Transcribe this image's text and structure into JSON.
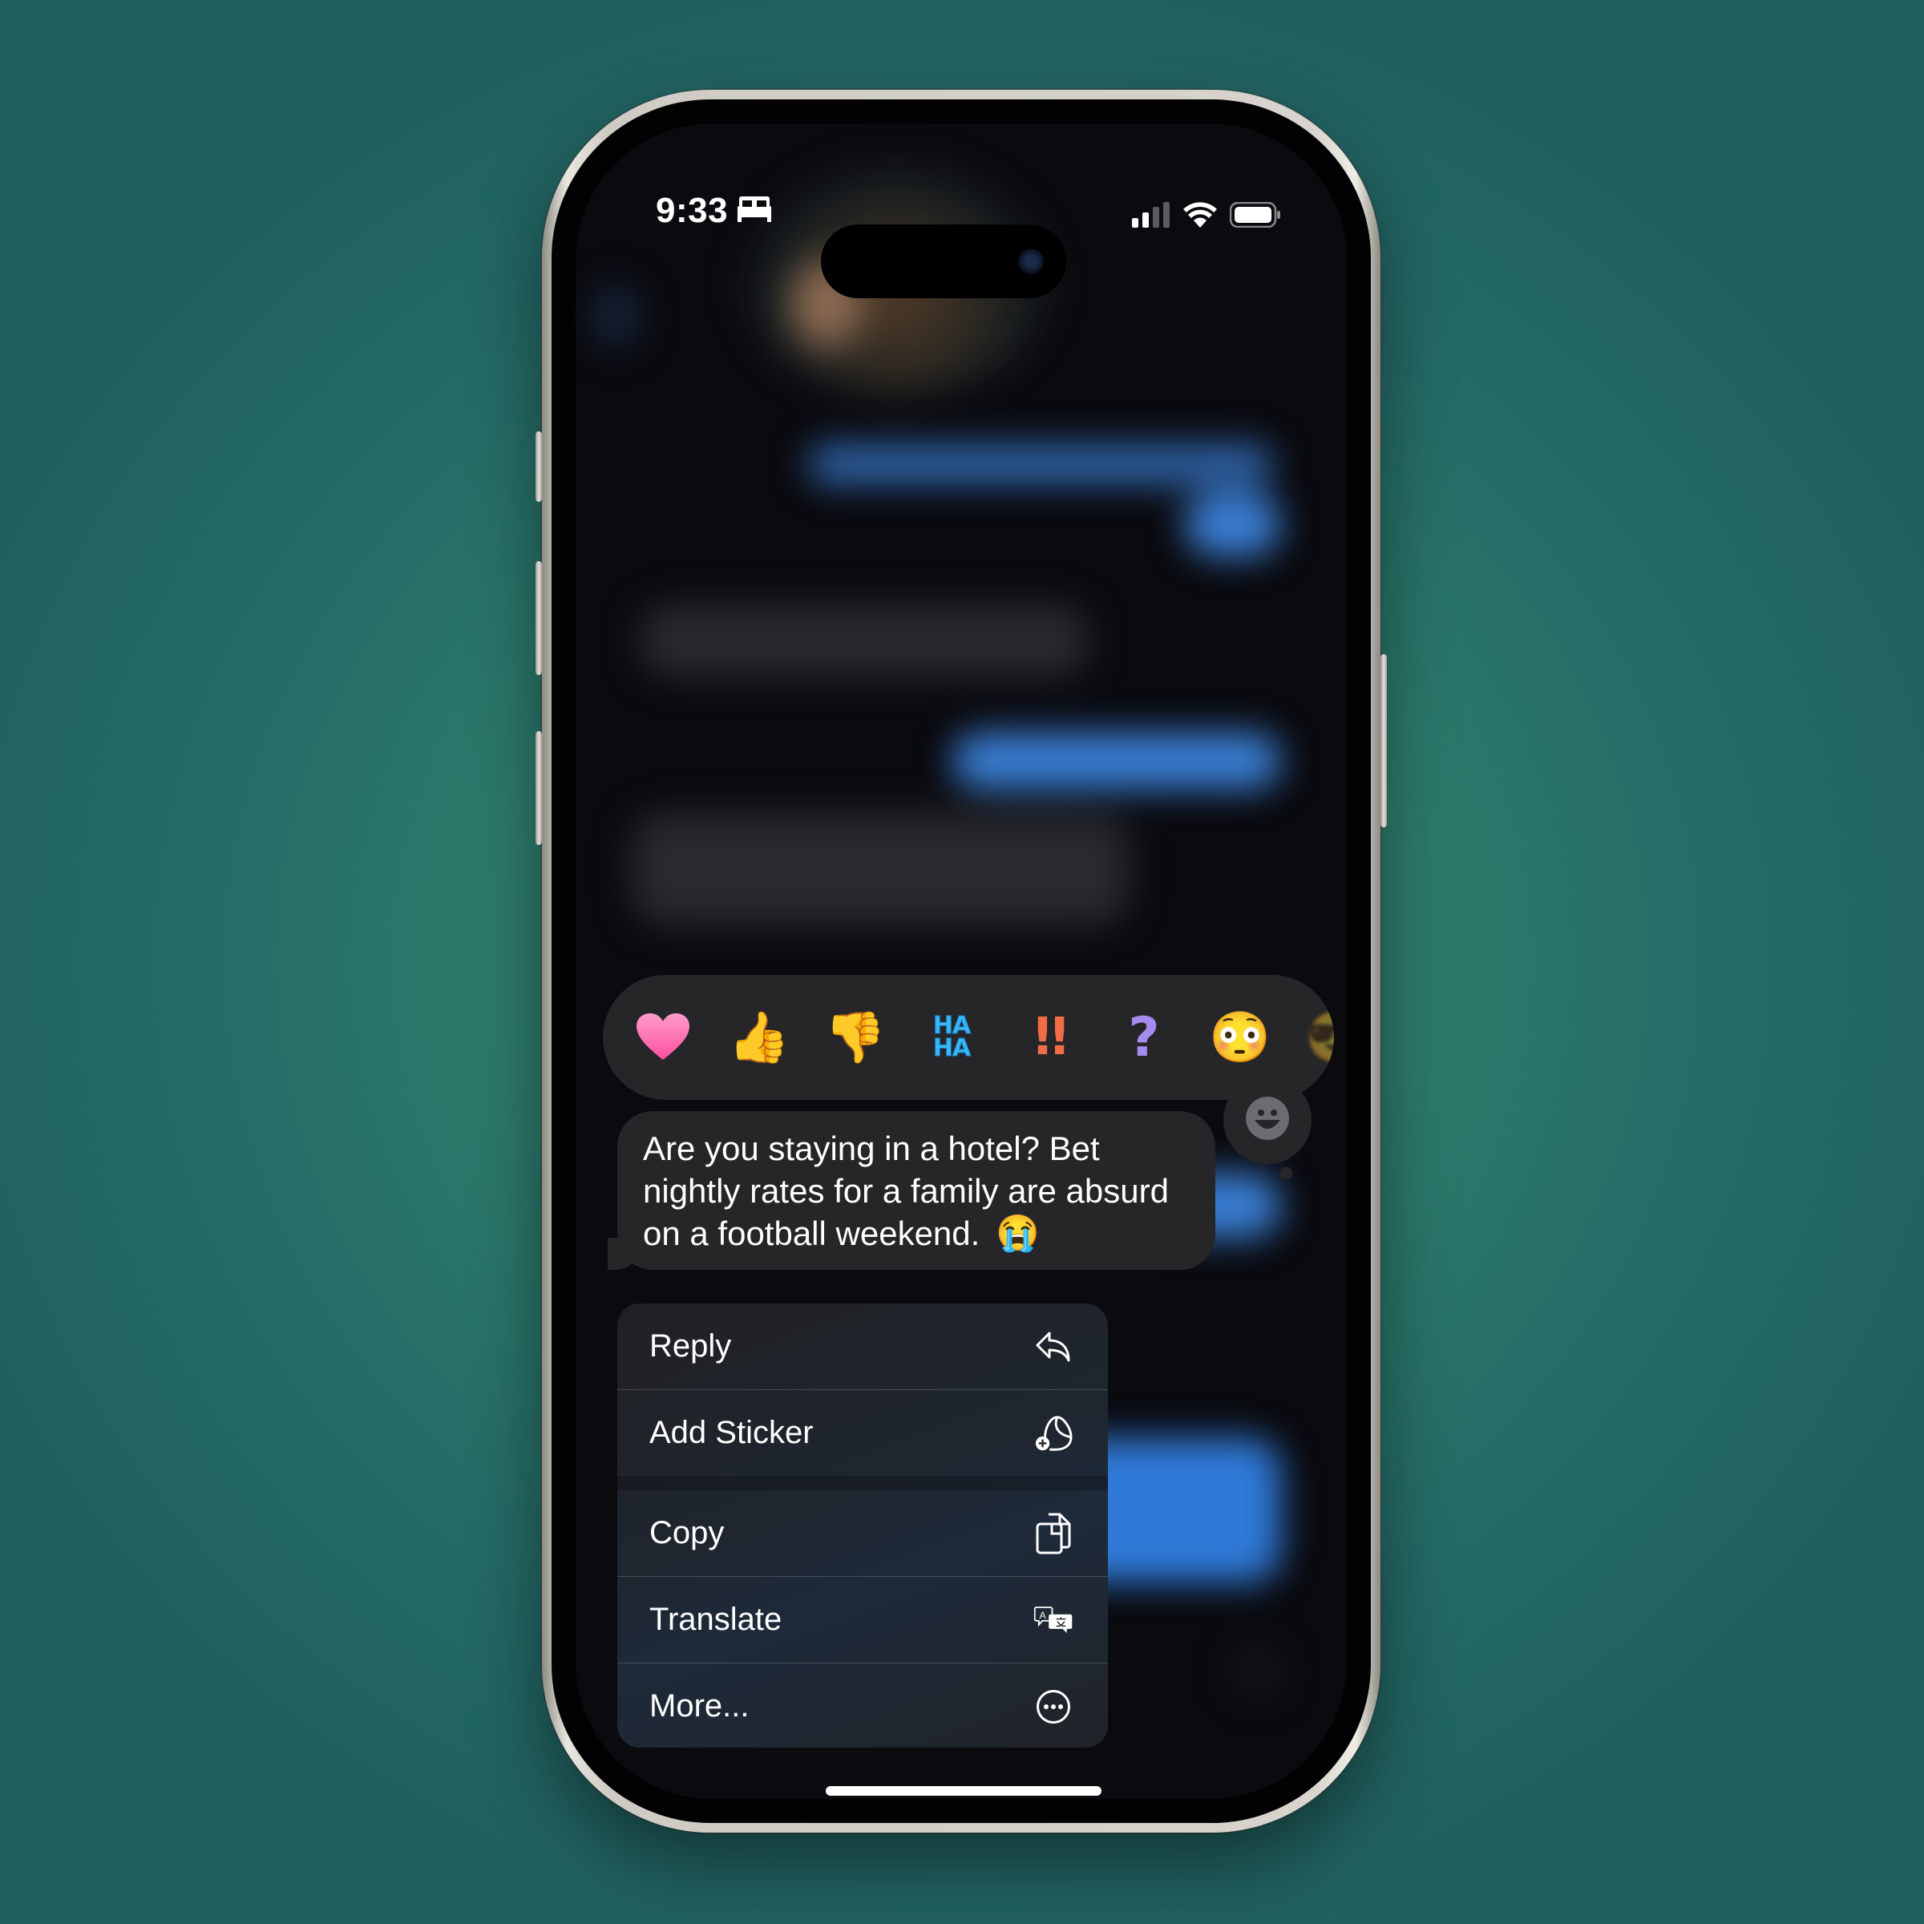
{
  "status_bar": {
    "time": "9:33",
    "focus_icon": "bed-icon",
    "signal_bars_active": 2,
    "signal_bars_total": 4,
    "wifi_icon": "wifi-icon",
    "battery_icon": "battery-icon"
  },
  "reactions": [
    {
      "name": "heart",
      "glyph": "❤"
    },
    {
      "name": "thumbs-up",
      "glyph": "👍"
    },
    {
      "name": "thumbs-down",
      "glyph": "👎"
    },
    {
      "name": "haha",
      "line1": "HA",
      "line2": "HA"
    },
    {
      "name": "exclamation",
      "glyph": "!!"
    },
    {
      "name": "question",
      "glyph": "?"
    },
    {
      "name": "flushed-face",
      "glyph": "😳"
    },
    {
      "name": "more-emoji-partial",
      "glyph": "😎"
    }
  ],
  "emoji_picker_icon": "smiley-face-icon",
  "message": {
    "text": "Are you staying in a hotel? Bet nightly rates for a family are absurd on a football weekend.",
    "emoji": "😭"
  },
  "menu": {
    "items": [
      {
        "label": "Reply",
        "icon": "reply-arrow-icon"
      },
      {
        "label": "Add Sticker",
        "icon": "add-sticker-icon"
      },
      {
        "label": "Copy",
        "icon": "copy-documents-icon"
      },
      {
        "label": "Translate",
        "icon": "translate-icon"
      },
      {
        "label": "More...",
        "icon": "ellipsis-circle-icon"
      }
    ]
  },
  "colors": {
    "background": "#2d7c6c",
    "bubble": "#262628",
    "blurred_sent_bubble": "#3a7fd5"
  }
}
